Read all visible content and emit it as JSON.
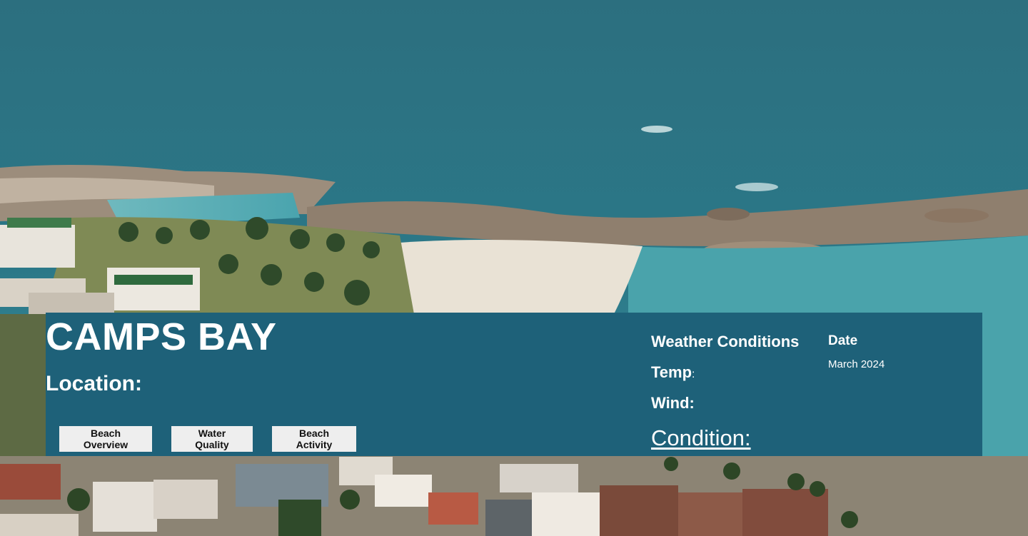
{
  "hero": {
    "title": "CAMPS BAY",
    "location_label": "Location:"
  },
  "buttons": {
    "beach_overview": "Beach Overview",
    "water_quality": "Water Quality",
    "beach_activity": "Beach Activity"
  },
  "weather": {
    "title": "Weather Conditions",
    "temp_label": "Temp",
    "temp_colon": ":",
    "wind_label": "Wind:",
    "condition_label": "Condition:"
  },
  "date": {
    "label": "Date",
    "value": "March 2024"
  },
  "colors": {
    "panel": "#1e6179",
    "ocean": "#2b7787",
    "button_bg": "#eeeeee"
  }
}
